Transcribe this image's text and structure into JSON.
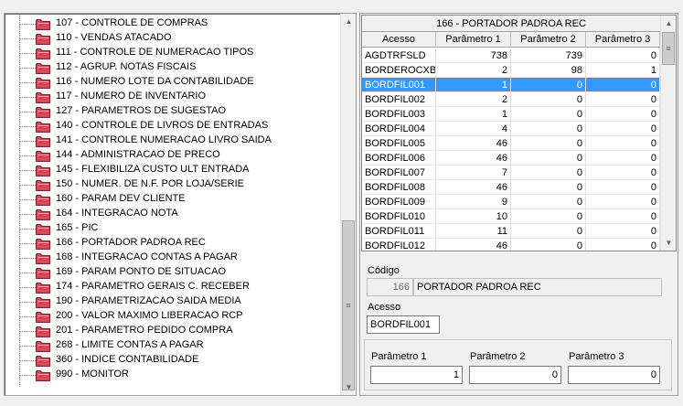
{
  "tree": {
    "items": [
      "107 - CONTROLE DE COMPRAS",
      "110 - VENDAS ATACADO",
      "111 - CONTROLE DE NUMERACAO TIPOS",
      "112 - AGRUP. NOTAS FISCAIS",
      "116 - NUMERO LOTE DA CONTABILIDADE",
      "117 - NUMERO DE INVENTARIO",
      "127 - PARAMETROS DE SUGESTAO",
      "140 - CONTROLE DE LIVROS DE ENTRADAS",
      "141 - CONTROLE NUMERACAO LIVRO SAIDA",
      "144 - ADMINISTRACAO DE PRECO",
      "145 - FLEXIBILIZA CUSTO ULT ENTRADA",
      "150 - NUMER. DE N.F. POR LOJA/SERIE",
      "160 - PARAM DEV CLIENTE",
      "164 - INTEGRACAO NOTA",
      "165 - PIC",
      "166 - PORTADOR PADROA REC",
      "168 - INTEGRACAO CONTAS A PAGAR",
      "169 - PARAM PONTO DE SITUACAO",
      "174 - PARAMETRO GERAIS C. RECEBER",
      "190 - PARAMETRIZACAO SAIDA MEDIA",
      "200 - VALOR MAXIMO LIBERACAO RCP",
      "201 - PARAMETRO PEDIDO COMPRA",
      "268 - LIMITE CONTAS A PAGAR",
      "360 - INDICE CONTABILIDADE",
      "990 - MONITOR"
    ],
    "folder_color": "#d9485a",
    "scroll_up_icon": "triangle-up-icon",
    "scroll_down_icon": "triangle-down-icon",
    "thumb_grip": "≡"
  },
  "grid": {
    "title": "166 - PORTADOR PADROA REC",
    "columns": [
      "Acesso",
      "Parâmetro 1",
      "Parâmetro 2",
      "Parâmetro 3"
    ],
    "rows": [
      [
        "AGDTRFSLD",
        "738",
        "739",
        "0"
      ],
      [
        "BORDEROCXB",
        "2",
        "98",
        "1"
      ],
      [
        "BORDFIL001",
        "1",
        "0",
        "0"
      ],
      [
        "BORDFIL002",
        "2",
        "0",
        "0"
      ],
      [
        "BORDFIL003",
        "1",
        "0",
        "0"
      ],
      [
        "BORDFIL004",
        "4",
        "0",
        "0"
      ],
      [
        "BORDFIL005",
        "46",
        "0",
        "0"
      ],
      [
        "BORDFIL006",
        "46",
        "0",
        "0"
      ],
      [
        "BORDFIL007",
        "7",
        "0",
        "0"
      ],
      [
        "BORDFIL008",
        "46",
        "0",
        "0"
      ],
      [
        "BORDFIL009",
        "9",
        "0",
        "0"
      ],
      [
        "BORDFIL010",
        "10",
        "0",
        "0"
      ],
      [
        "BORDFIL011",
        "11",
        "0",
        "0"
      ],
      [
        "BORDFIL012",
        "46",
        "0",
        "0"
      ]
    ],
    "selected_row": "BORDFIL001",
    "selection_color": "#3399ff"
  },
  "form": {
    "codigo_label": "Código",
    "codigo_value": "166",
    "codigo_desc": "PORTADOR PADROA REC",
    "acesso_label": "Acesso",
    "acesso_value": "BORDFIL001",
    "param1_label": "Parâmetro 1",
    "param1_value": "1",
    "param2_label": "Parâmetro 2",
    "param2_value": "0",
    "param3_label": "Parâmetro 3",
    "param3_value": "0"
  }
}
